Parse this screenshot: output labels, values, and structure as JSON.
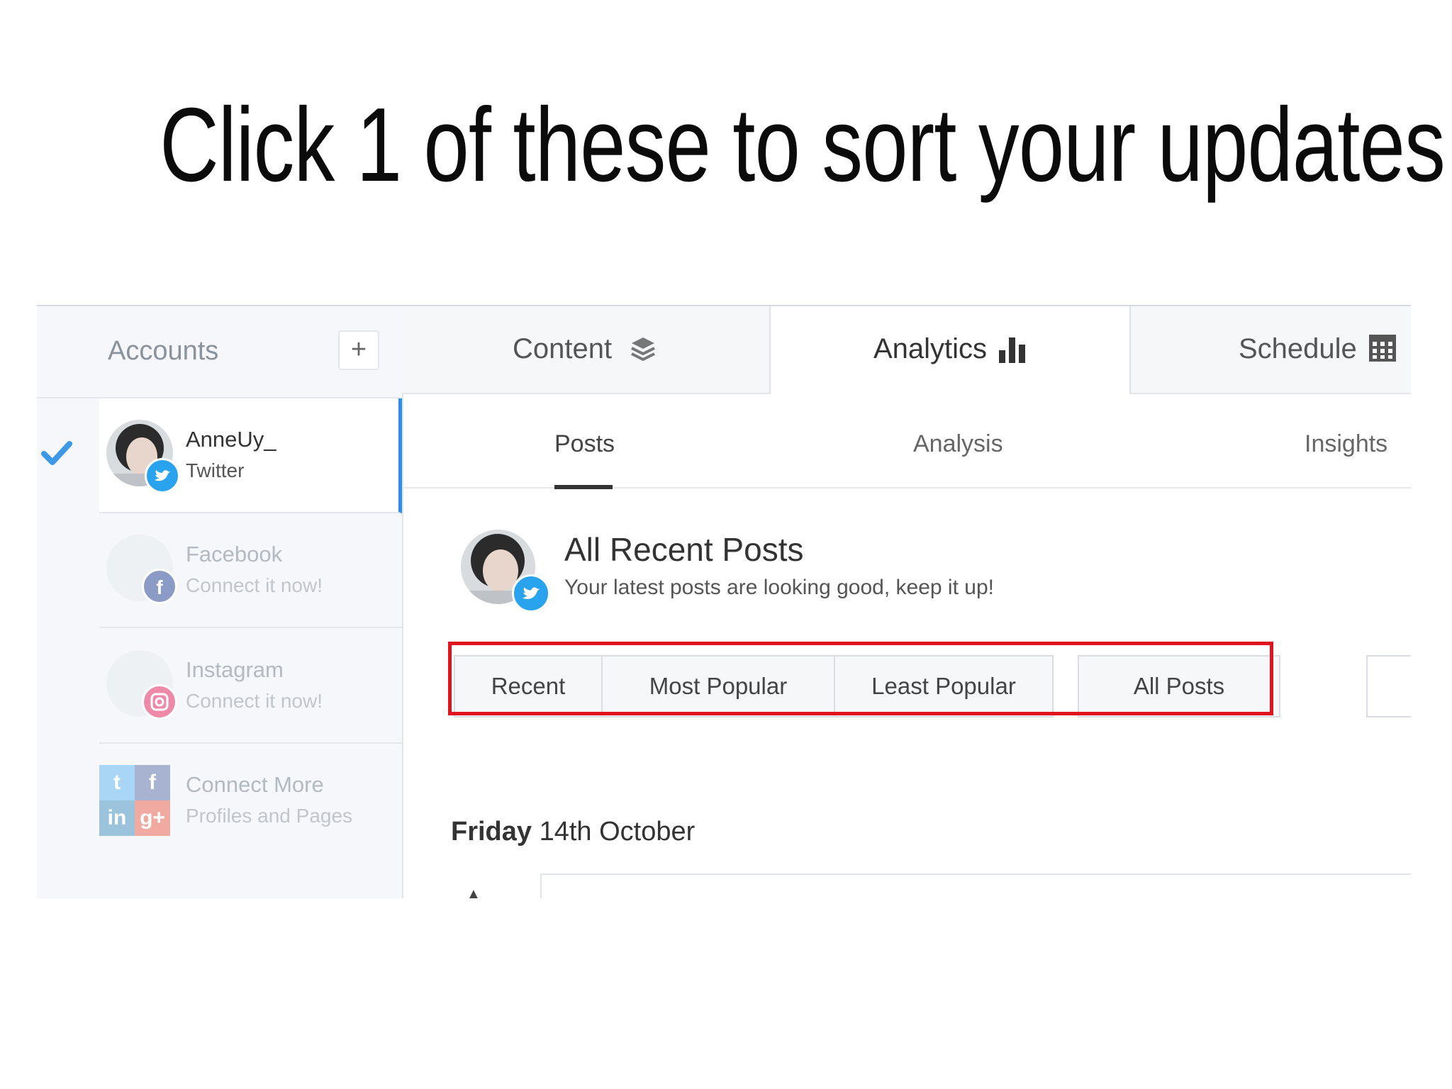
{
  "headline": "Click 1 of these to sort your updates.",
  "sidebar": {
    "title": "Accounts",
    "add_label": "+",
    "accounts": [
      {
        "name": "AnneUy_",
        "network": "Twitter",
        "status": "connected",
        "icon": "twitter-icon"
      },
      {
        "name": "Facebook",
        "network": "Connect it now!",
        "status": "disconnected",
        "icon": "facebook-icon"
      },
      {
        "name": "Instagram",
        "network": "Connect it now!",
        "status": "disconnected",
        "icon": "instagram-icon"
      },
      {
        "name": "Connect More",
        "network": "Profiles and Pages",
        "status": "action",
        "icon": "social-grid-icon"
      }
    ],
    "grid_glyphs": [
      "t",
      "f",
      "in",
      "g+"
    ]
  },
  "tabs": [
    {
      "label": "Content",
      "icon": "layers-icon"
    },
    {
      "label": "Analytics",
      "icon": "bar-chart-icon",
      "selected": true
    },
    {
      "label": "Schedule",
      "icon": "calendar-icon"
    }
  ],
  "subtabs": [
    {
      "label": "Posts",
      "selected": true
    },
    {
      "label": "Analysis"
    },
    {
      "label": "Insights"
    }
  ],
  "feed": {
    "title": "All Recent Posts",
    "subtitle": "Your latest posts are looking good, keep it up!"
  },
  "sort_options": [
    "Recent",
    "Most Popular",
    "Least Popular",
    "All Posts"
  ],
  "date_day": "Friday",
  "date_rest": " 14th October",
  "colors": {
    "accent": "#2b8fe8",
    "highlight": "#e0141e",
    "twitter": "#2aa3ef",
    "facebook": "#3b5998",
    "instagram": "#e1306c",
    "googleplus": "#dd4b39"
  }
}
